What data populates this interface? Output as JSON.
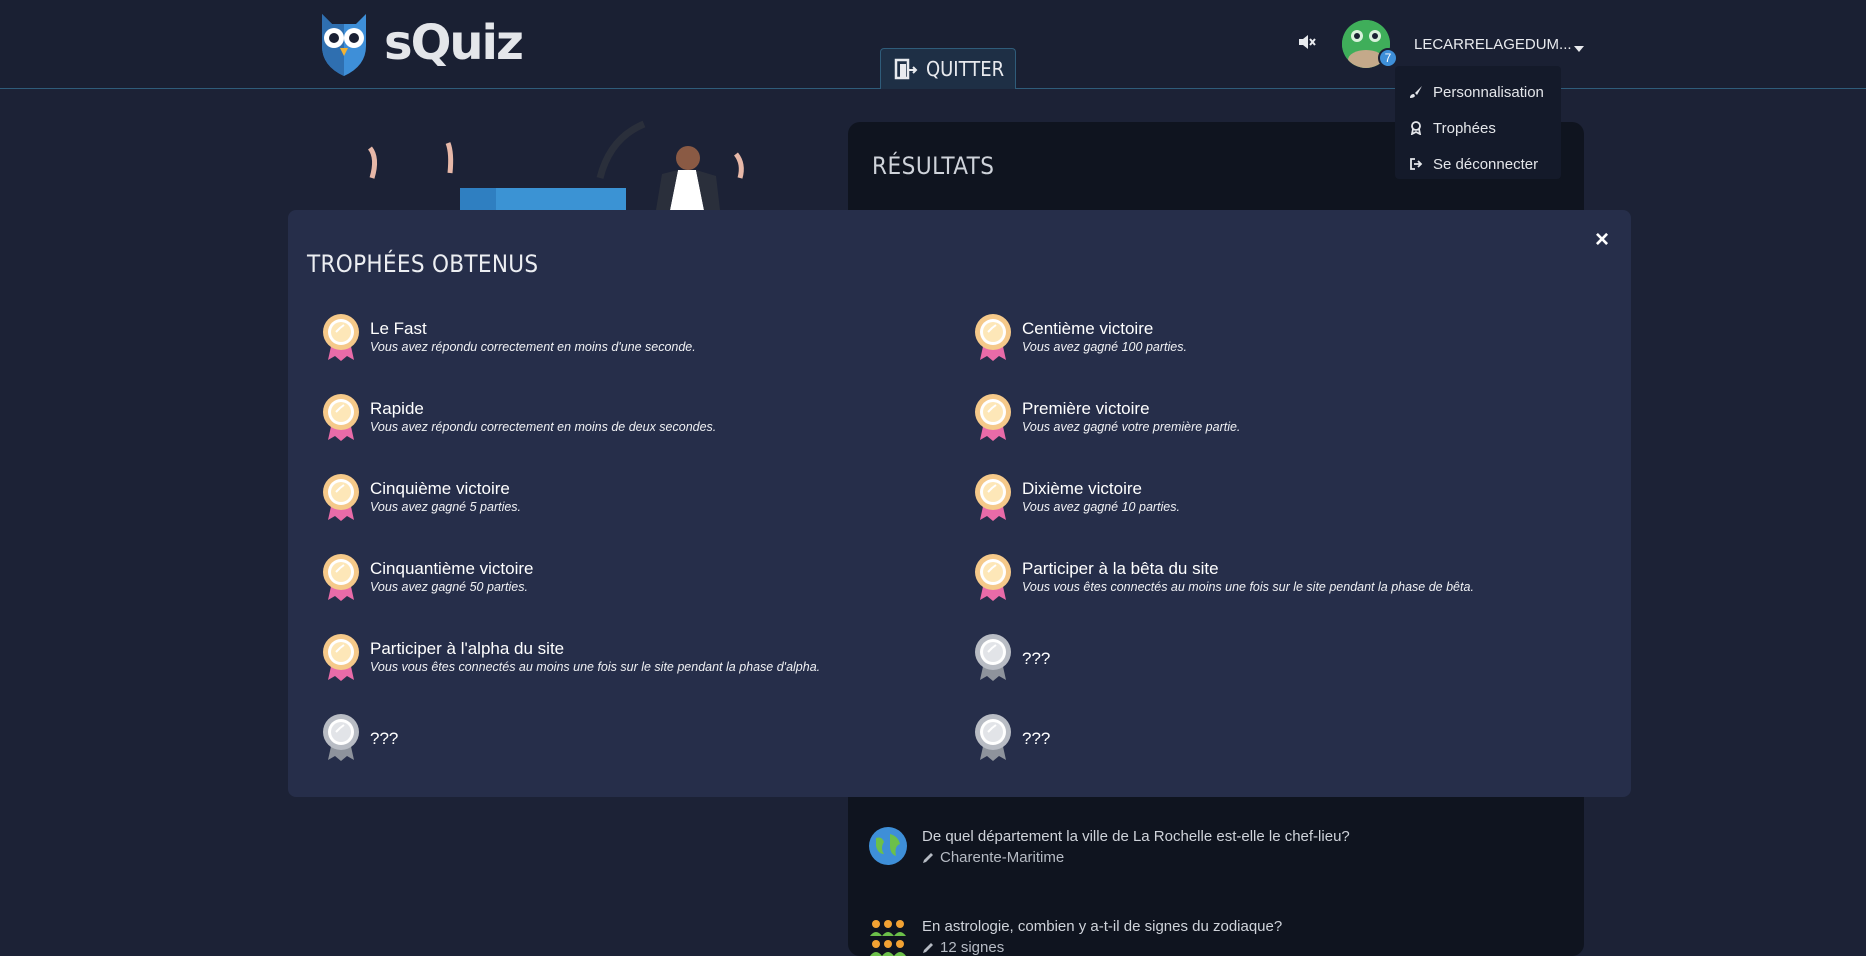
{
  "header": {
    "logo_text": "sQuiz",
    "quit_label": "QUITTER",
    "username": "LECARRELAGEDUM...",
    "level": "7"
  },
  "user_menu": {
    "items": [
      {
        "label": "Personnalisation",
        "icon": "brush-icon"
      },
      {
        "label": "Trophées",
        "icon": "award-icon"
      },
      {
        "label": "Se déconnecter",
        "icon": "logout-icon"
      }
    ]
  },
  "results": {
    "title": "RÉSULTATS",
    "questions": [
      {
        "question": "De quel département la ville de La Rochelle est-elle le chef-lieu?",
        "answer": "Charente-Maritime",
        "icon": "globe-icon"
      },
      {
        "question": "En astrologie, combien y a-t-il de signes du zodiaque?",
        "answer": "12 signes",
        "icon": "people-icon"
      }
    ]
  },
  "trophies_modal": {
    "title": "TROPHÉES OBTENUS",
    "close_label": "×",
    "trophies": [
      {
        "title": "Le Fast",
        "description": "Vous avez répondu correctement en moins d'une seconde.",
        "unlocked": true
      },
      {
        "title": "Centième victoire",
        "description": "Vous avez gagné 100 parties.",
        "unlocked": true
      },
      {
        "title": "Rapide",
        "description": "Vous avez répondu correctement en moins de deux secondes.",
        "unlocked": true
      },
      {
        "title": "Première victoire",
        "description": "Vous avez gagné votre première partie.",
        "unlocked": true
      },
      {
        "title": "Cinquième victoire",
        "description": "Vous avez gagné 5 parties.",
        "unlocked": true
      },
      {
        "title": "Dixième victoire",
        "description": "Vous avez gagné 10 parties.",
        "unlocked": true
      },
      {
        "title": "Cinquantième victoire",
        "description": "Vous avez gagné 50 parties.",
        "unlocked": true
      },
      {
        "title": "Participer à la bêta du site",
        "description": "Vous vous êtes connectés au moins une fois sur le site pendant la phase de bêta.",
        "unlocked": true
      },
      {
        "title": "Participer à l'alpha du site",
        "description": "Vous vous êtes connectés au moins une fois sur le site pendant la phase d'alpha.",
        "unlocked": true
      },
      {
        "title": "???",
        "description": "",
        "unlocked": false
      },
      {
        "title": "???",
        "description": "",
        "unlocked": false
      },
      {
        "title": "???",
        "description": "",
        "unlocked": false
      }
    ]
  },
  "colors": {
    "background": "#1c2236",
    "modal": "#262e4a",
    "results_panel": "#0f141f",
    "accent_blue": "#3e8fd8"
  }
}
